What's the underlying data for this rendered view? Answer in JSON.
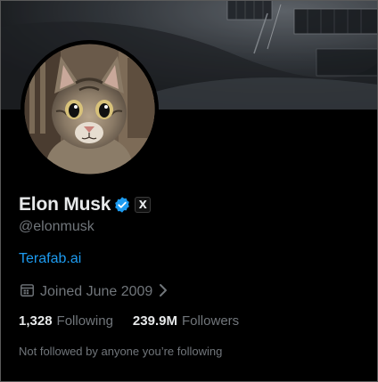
{
  "profile": {
    "display_name": "Elon Musk",
    "handle": "@elonmusk",
    "website": "Terafab.ai",
    "joined": "Joined June 2009",
    "affiliate_badge": "X"
  },
  "stats": {
    "following_count": "1,328",
    "following_label": "Following",
    "followers_count": "239.9M",
    "followers_label": "Followers"
  },
  "followed_by": "Not followed by anyone you’re following",
  "icons": {
    "verified": "verified-badge-icon",
    "calendar": "calendar-icon",
    "chevron": "chevron-right-icon"
  },
  "colors": {
    "background": "#000000",
    "primary_text": "#e7e9ea",
    "secondary_text": "#71767b",
    "link": "#1d9bf0",
    "verified": "#1d9bf0"
  }
}
